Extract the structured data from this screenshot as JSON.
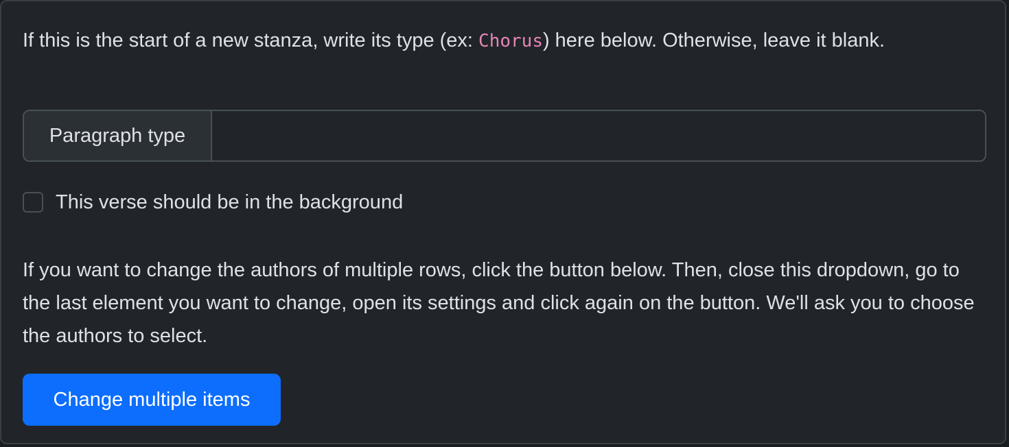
{
  "intro": {
    "before": "If this is the start of a new stanza, write its type (ex: ",
    "example": "Chorus",
    "after": ") here below. Otherwise, leave it blank."
  },
  "paragraph_type": {
    "label": "Paragraph type",
    "value": "",
    "placeholder": ""
  },
  "background_checkbox": {
    "label": "This verse should be in the background",
    "checked": false
  },
  "multi_edit": {
    "explanation": "If you want to change the authors of multiple rows, click the button below. Then, close this dropdown, go to the last element you want to change, open its settings and click again on the button. We'll ask you to choose the authors to select.",
    "button_label": "Change multiple items"
  },
  "colors": {
    "background": "#212529",
    "accent": "#0d6efd",
    "code": "#e685b5",
    "text": "#dee2e6"
  }
}
